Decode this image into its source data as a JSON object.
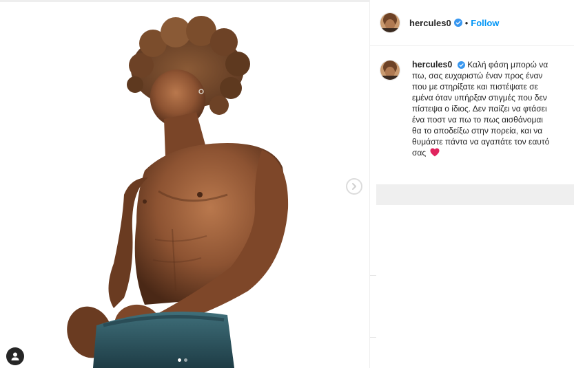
{
  "post": {
    "username": "hercules0",
    "follow_label": "Follow",
    "separator": "•",
    "caption": "Καλή φάση μπορώ να πω, σας ευχαριστώ έναν προς έναν που με στηρίξατε και πιστέψατε σε εμένα όταν υπήρξαν στιγμές που δεν πίστεψα ο ίδιος. Δεν παίζει να φτάσει ένα ποστ να πω το πως αισθάνομαι θα το αποδείξω στην πορεία, και να θυμάστε πάντα να αγαπάτε τον εαυτό σας",
    "carousel": {
      "current": 1,
      "total": 2
    }
  },
  "icons": {
    "verified": "verified-badge-icon",
    "heart": "red-heart-emoji",
    "next": "chevron-right-icon",
    "tags": "user-tag-icon"
  },
  "colors": {
    "link": "#0095f6",
    "verified": "#3897f0",
    "text": "#262626",
    "heart": "#e0245e"
  }
}
